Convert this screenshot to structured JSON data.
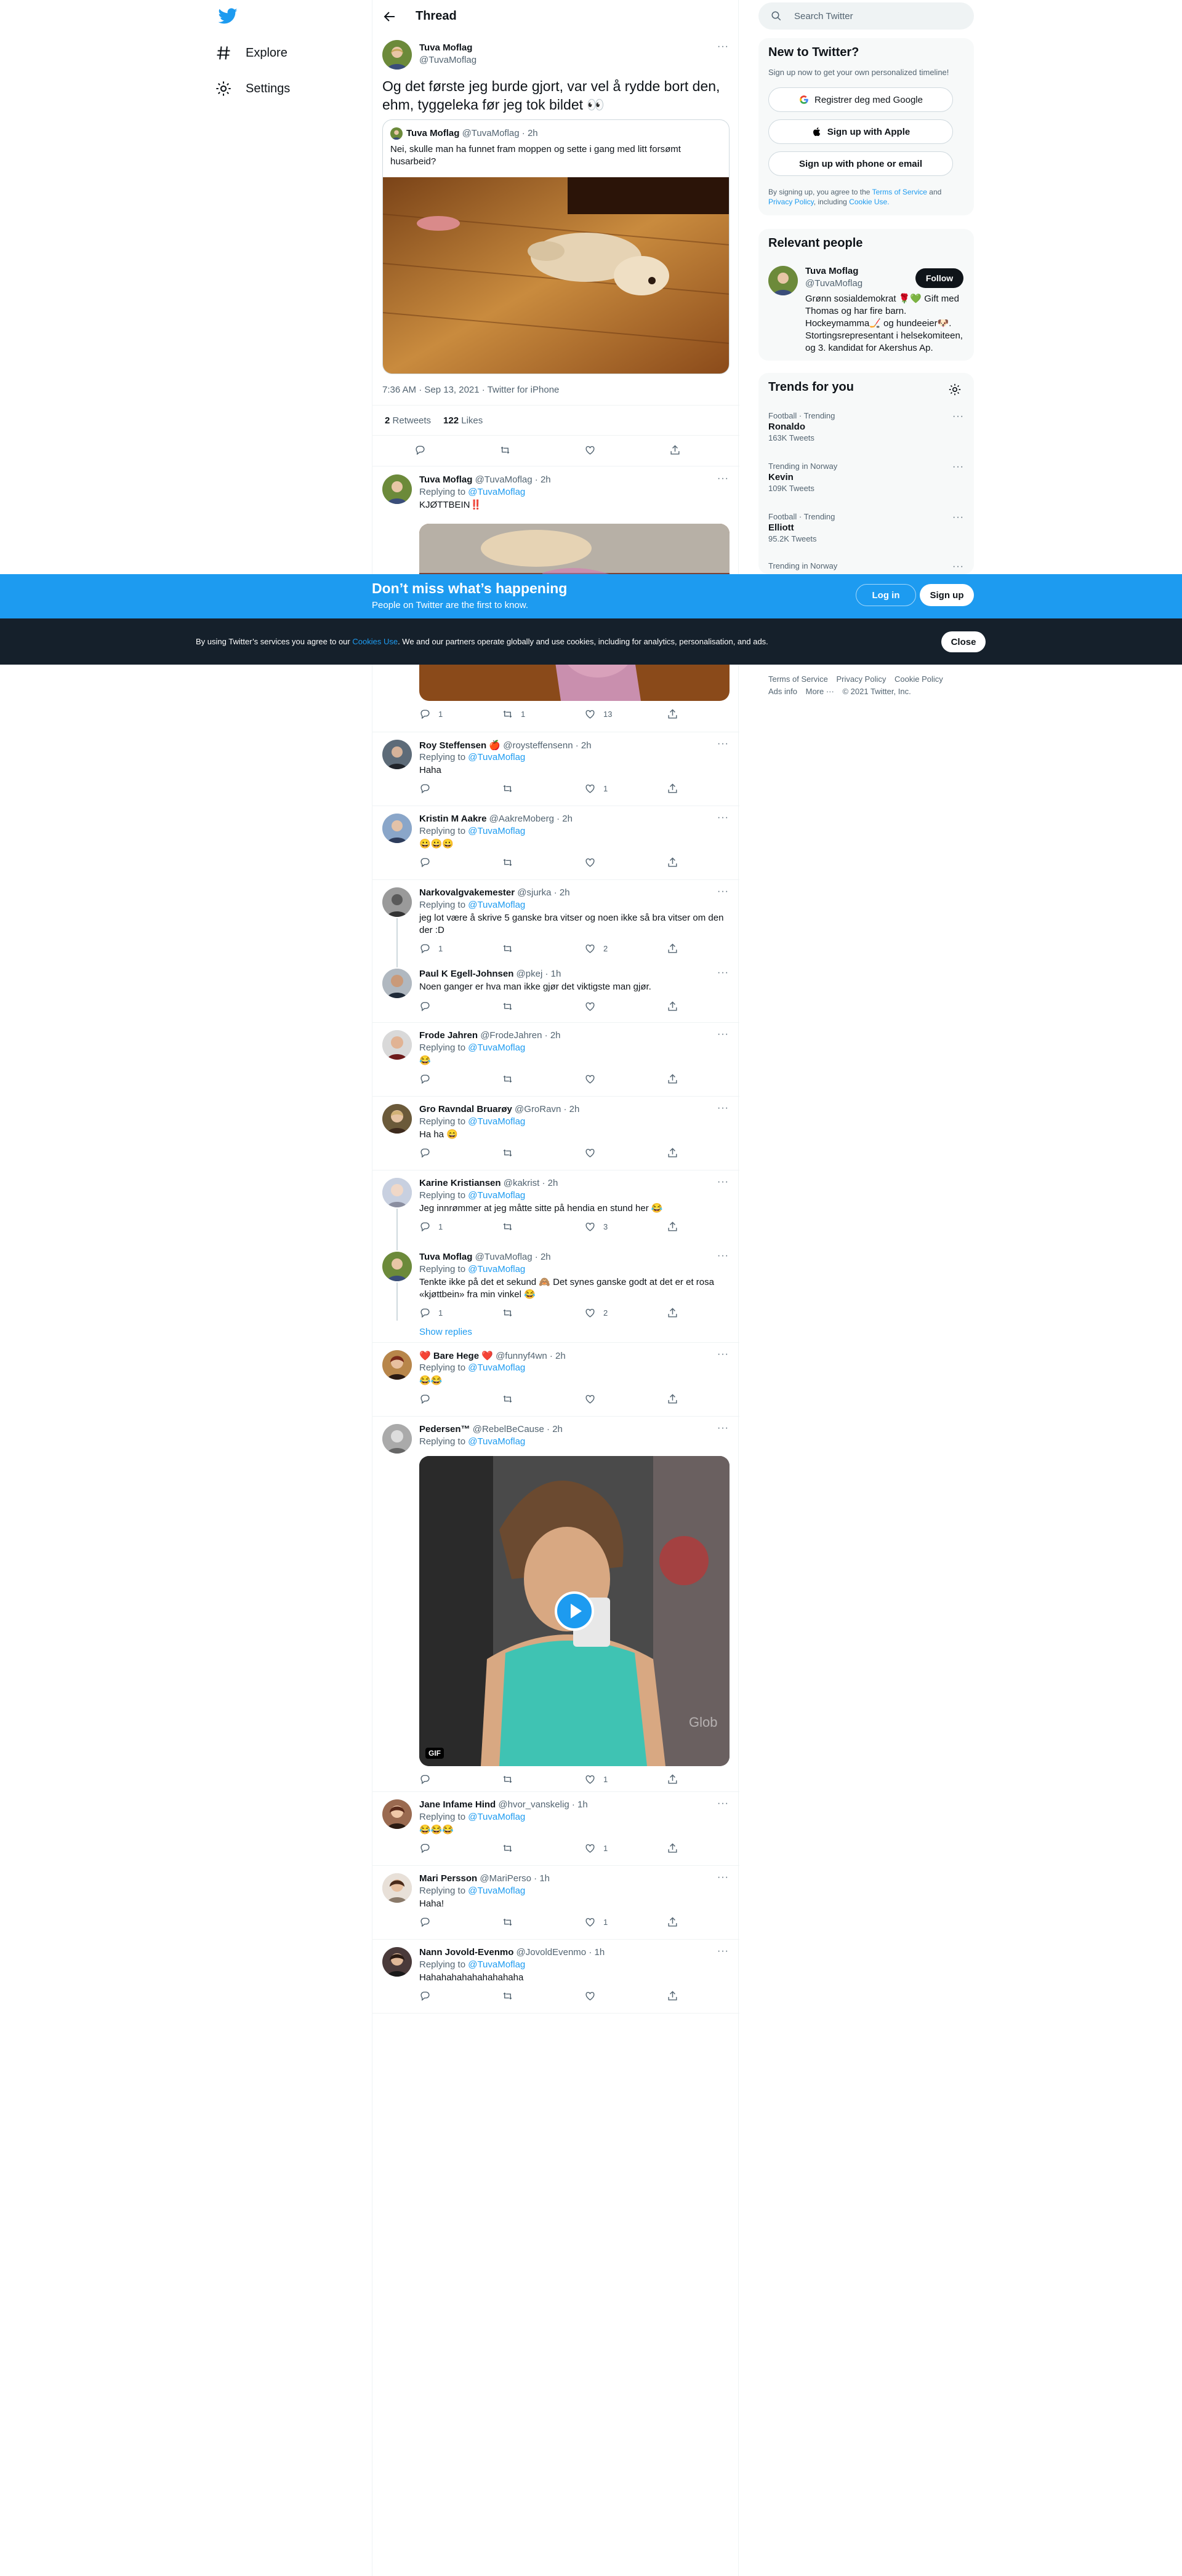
{
  "nav": {
    "items": [
      {
        "label": "Explore",
        "icon": "hashtag-icon"
      },
      {
        "label": "Settings",
        "icon": "gear-icon"
      }
    ]
  },
  "header": {
    "title": "Thread"
  },
  "main_tweet": {
    "name": "Tuva Moflag",
    "handle": "@TuvaMoflag",
    "text": "Og det første jeg burde gjort, var vel å rydde bort den, ehm, tyggeleka før jeg tok bildet 👀",
    "quote": {
      "name": "Tuva Moflag",
      "handle": "@TuvaMoflag",
      "time": "2h",
      "text": "Nei, skulle man ha funnet fram moppen og sette i gang med litt forsømt husarbeid?"
    },
    "timestamp": "7:36 AM · Sep 13, 2021 · Twitter for iPhone",
    "retweets": "2",
    "retweets_label": "Retweets",
    "likes": "122",
    "likes_label": "Likes"
  },
  "replying_to_label": "Replying to",
  "replies": [
    {
      "name": "Tuva Moflag",
      "handle": "@TuvaMoflag",
      "time": "2h",
      "replying": "@TuvaMoflag",
      "text": "KJØTTBEIN‼️",
      "replies": "1",
      "retweets": "1",
      "likes": "13"
    },
    {
      "name": "Roy Steffensen 🍎",
      "handle": "@roysteffensenn",
      "time": "2h",
      "replying": "@TuvaMoflag",
      "text": "Haha",
      "replies": "",
      "retweets": "",
      "likes": "1"
    },
    {
      "name": "Kristin M Aakre",
      "handle": "@AakreMoberg",
      "time": "2h",
      "replying": "@TuvaMoflag",
      "text": "😀😀😀",
      "replies": "",
      "retweets": "",
      "likes": ""
    },
    {
      "name": "Narkovalgvakemester",
      "handle": "@sjurka",
      "time": "2h",
      "replying": "@TuvaMoflag",
      "text": "jeg lot være å skrive 5 ganske bra vitser og noen ikke så bra vitser om den der :D",
      "replies": "1",
      "retweets": "",
      "likes": "2"
    },
    {
      "name": "Paul K Egell-Johnsen",
      "handle": "@pkej",
      "time": "1h",
      "replying": "",
      "text": "Noen ganger er hva man ikke gjør det viktigste man gjør.",
      "replies": "",
      "retweets": "",
      "likes": ""
    },
    {
      "name": "Frode Jahren",
      "handle": "@FrodeJahren",
      "time": "2h",
      "replying": "@TuvaMoflag",
      "text": "😂",
      "replies": "",
      "retweets": "",
      "likes": ""
    },
    {
      "name": "Gro Ravndal Bruarøy",
      "handle": "@GroRavn",
      "time": "2h",
      "replying": "",
      "text": "Ha ha 😄",
      "replies": "",
      "retweets": "",
      "likes": ""
    },
    {
      "name": "Karine Kristiansen",
      "handle": "@kakrist",
      "time": "2h",
      "replying": "@TuvaMoflag",
      "text": "Jeg innrømmer at jeg måtte sitte på hendia en stund her 😂",
      "replies": "1",
      "retweets": "",
      "likes": "3"
    },
    {
      "name": "Tuva Moflag",
      "handle": "@TuvaMoflag",
      "time": "2h",
      "replying": "@TuvaMoflag",
      "text": "Tenkte ikke på det et sekund 🙈 Det synes ganske godt at det er et rosa «kjøttbein» fra min vinkel 😂",
      "replies": "1",
      "retweets": "",
      "likes": "2",
      "show_replies": "Show replies"
    },
    {
      "name": "❤️ Bare Hege ❤️",
      "handle": "@funnyf4wn",
      "time": "2h",
      "replying": "@TuvaMoflag",
      "text": "😂😂",
      "replies": "",
      "retweets": "",
      "likes": ""
    },
    {
      "name": "Pedersen™",
      "handle": "@RebelBeCause",
      "time": "2h",
      "replying": "@TuvaMoflag",
      "text": "",
      "gif_label": "GIF",
      "replies": "",
      "retweets": "",
      "likes": "1"
    },
    {
      "name": "Jane Infame Hind",
      "handle": "@hvor_vanskelig",
      "time": "1h",
      "replying": "@TuvaMoflag",
      "text": "😂😂😂",
      "replies": "",
      "retweets": "",
      "likes": "1"
    },
    {
      "name": "Mari Persson",
      "handle": "@MariPerso",
      "time": "1h",
      "replying": "@TuvaMoflag",
      "text": "Haha!",
      "replies": "",
      "retweets": "",
      "likes": "1"
    },
    {
      "name": "Nann Jovold-Evenmo",
      "handle": "@JovoldEvenmo",
      "time": "1h",
      "replying": "@TuvaMoflag",
      "text": "Hahahahahahahahahaha",
      "replies": "",
      "retweets": "",
      "likes": ""
    }
  ],
  "sidebar": {
    "search_placeholder": "Search Twitter",
    "new_title": "New to Twitter?",
    "new_sub": "Sign up now to get your own personalized timeline!",
    "google_btn": "Registrer deg med Google",
    "apple_btn": "Sign up with Apple",
    "phone_btn": "Sign up with phone or email",
    "terms_prefix": "By signing up, you agree to the",
    "terms_link": "Terms of Service",
    "terms_and": "and",
    "privacy_link": "Privacy Policy",
    "terms_including": ", including",
    "cookie_link": "Cookie Use.",
    "relevant_title": "Relevant people",
    "person": {
      "name": "Tuva Moflag",
      "handle": "@TuvaMoflag",
      "follow": "Follow",
      "bio": "Grønn sosialdemokrat 🌹💚 Gift med Thomas og har fire barn. Hockeymamma🏒 og hundeeier🐶. Stortingsrepresentant i helsekomiteen, og 3. kandidat for Akershus Ap."
    },
    "trends_title": "Trends for you",
    "trends": [
      {
        "meta": "Football · Trending",
        "name": "Ronaldo",
        "count": "163K Tweets"
      },
      {
        "meta": "Trending in Norway",
        "name": "Kevin",
        "count": "109K Tweets"
      },
      {
        "meta": "Football · Trending",
        "name": "Elliott",
        "count": "95.2K Tweets"
      },
      {
        "meta": "Trending in Norway",
        "name": "",
        "count": ""
      }
    ],
    "footer": [
      "Terms of Service",
      "Privacy Policy",
      "Cookie Policy",
      "Ads info",
      "More ···",
      "© 2021 Twitter, Inc."
    ]
  },
  "banner": {
    "title": "Don’t miss what’s happening",
    "sub": "People on Twitter are the first to know.",
    "login": "Log in",
    "signup": "Sign up"
  },
  "cookie": {
    "text_before": "By using Twitter’s services you agree to our",
    "link": "Cookies Use",
    "text_after": ". We and our partners operate globally and use cookies, including for analytics, personalisation, and ads.",
    "close": "Close"
  },
  "colors": {
    "accent": "#1d9bf0",
    "banner": "#1d9bf0",
    "cookie_bg": "#15202b"
  }
}
